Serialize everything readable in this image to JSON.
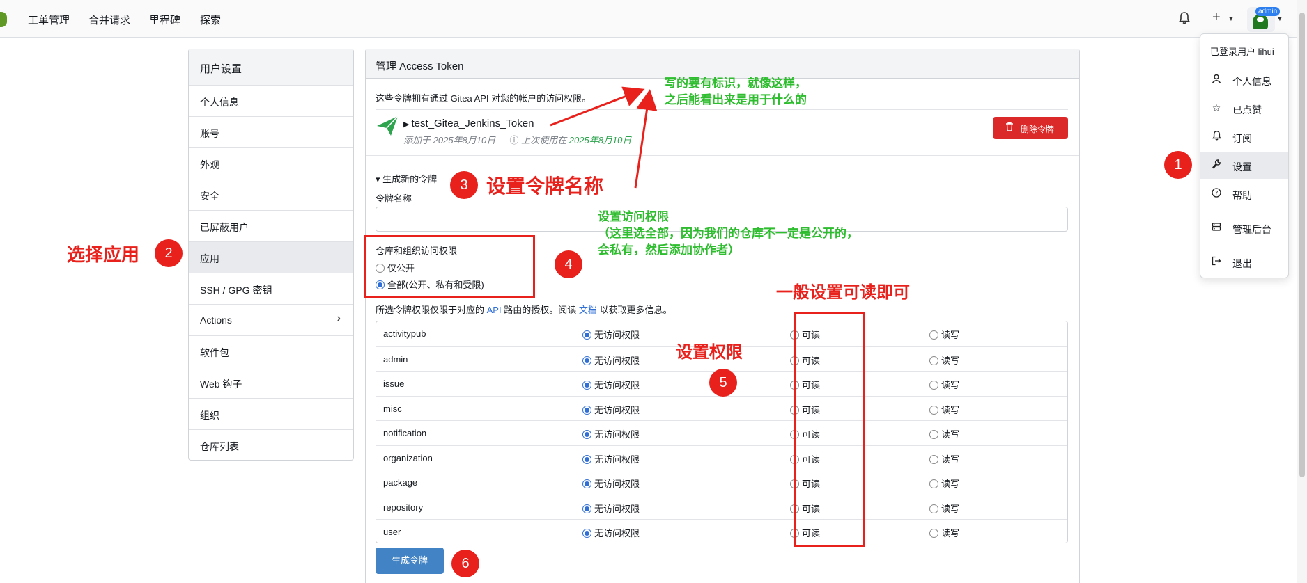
{
  "nav": {
    "links": [
      "工单管理",
      "合并请求",
      "里程碑",
      "探索"
    ],
    "plus": "+",
    "avatar_badge": "admin"
  },
  "dropdown": {
    "header": "已登录用户 lihui",
    "items": [
      {
        "label": "个人信息",
        "icon": "user-icon"
      },
      {
        "label": "已点赞",
        "icon": "star-icon"
      },
      {
        "label": "订阅",
        "icon": "bell-icon"
      },
      {
        "label": "设置",
        "icon": "wrench-icon"
      },
      {
        "label": "帮助",
        "icon": "help-icon"
      },
      {
        "label": "管理后台",
        "icon": "server-icon"
      },
      {
        "label": "退出",
        "icon": "sign-out-icon"
      }
    ]
  },
  "sidebar": {
    "title": "用户设置",
    "items": [
      "个人信息",
      "账号",
      "外观",
      "安全",
      "已屏蔽用户",
      "应用",
      "SSH / GPG 密钥",
      "Actions",
      "软件包",
      "Web 钩子",
      "组织",
      "仓库列表"
    ]
  },
  "panel": {
    "title": "管理 Access Token",
    "description": "这些令牌拥有通过 Gitea API 对您的帐户的访问权限。",
    "token": {
      "name": "test_Gitea_Jenkins_Token",
      "added_prefix": "添加于",
      "added_date": "2025年8月10日",
      "sep": "—",
      "last_used_prefix": "上次使用在",
      "last_used_date": "2025年8月10日",
      "delete_label": "删除令牌"
    },
    "generate_summary": "▾ 生成新的令牌",
    "name_label": "令牌名称",
    "name_value": "",
    "repo_access_label": "仓库和组织访问权限",
    "repo_public": "仅公开",
    "repo_all": "全部(公开、私有和受限)",
    "perm_desc_1": "所选令牌权限仅限于对应的",
    "perm_desc_api": "API",
    "perm_desc_2": "路由的授权。阅读",
    "perm_desc_docs": "文档",
    "perm_desc_3": "以获取更多信息。",
    "perm_options": [
      "无访问权限",
      "可读",
      "读写"
    ],
    "permissions": [
      "activitypub",
      "admin",
      "issue",
      "misc",
      "notification",
      "organization",
      "package",
      "repository",
      "user"
    ],
    "generate_button": "生成令牌"
  },
  "annotations": {
    "step1": "1",
    "step2": "2",
    "step3": "3",
    "step4": "4",
    "step5": "5",
    "step6": "6",
    "select_app": "选择应用",
    "set_token_name": "设置令牌名称",
    "set_permissions": "设置权限",
    "read_enough": "一般设置可读即可",
    "name_hint_1": "写的要有标识，就像这样，",
    "name_hint_2": "之后能看出来是用于什么的",
    "access_hint_1": "设置访问权限",
    "access_hint_2": "（这里选全部，因为我们的仓库不一定是公开的，",
    "access_hint_3": "会私有，然后添加协作者）"
  }
}
